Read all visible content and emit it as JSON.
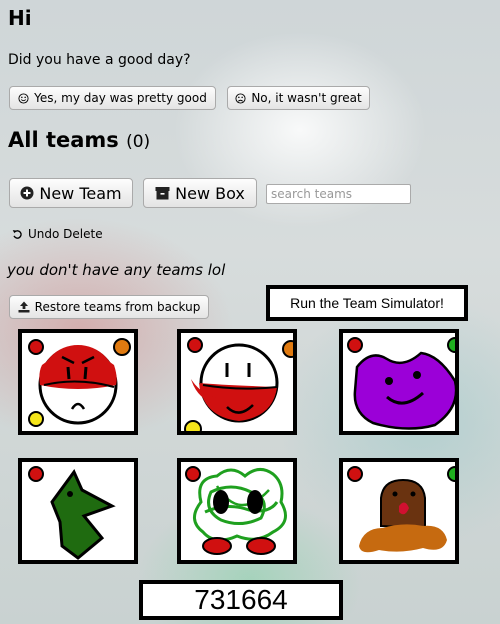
{
  "greeting": {
    "title": "Hi",
    "question": "Did you have a good day?"
  },
  "mood_buttons": [
    {
      "icon": "smile-icon",
      "label": "Yes, my day was pretty good"
    },
    {
      "icon": "frown-icon",
      "label": "No, it wasn't great"
    }
  ],
  "teams": {
    "title": "All teams",
    "count": "(0)",
    "new_team_label": "New Team",
    "new_box_label": "New Box",
    "search_placeholder": "search teams",
    "undo_label": "Undo Delete",
    "empty_message": "you don't have any teams lol",
    "restore_label": "Restore teams from backup"
  },
  "simulator": {
    "label": "Run the Team Simulator!"
  },
  "counter": {
    "value": "731664"
  },
  "colors": {
    "red": "#d01010",
    "green": "#1f6b10",
    "purple": "#9b00d8",
    "orange": "#e07a10",
    "yellow": "#f5e51a"
  },
  "creature_cards": [
    {
      "icon": "red-ball-creature-icon"
    },
    {
      "icon": "smiling-red-ball-creature-icon"
    },
    {
      "icon": "purple-blob-creature-icon"
    },
    {
      "icon": "green-bird-creature-icon"
    },
    {
      "icon": "green-bush-creature-icon"
    },
    {
      "icon": "brown-mole-creature-icon"
    }
  ]
}
